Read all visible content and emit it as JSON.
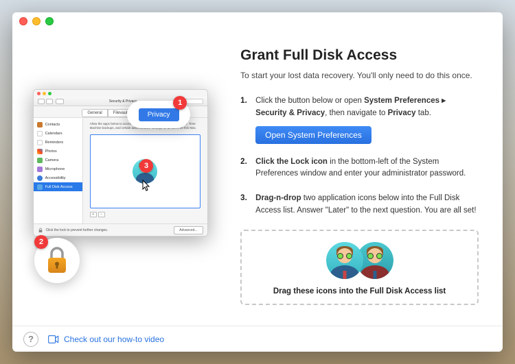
{
  "titlebar": {},
  "right": {
    "heading": "Grant Full Disk Access",
    "subtitle": "To start your lost data recovery. You'll only need to do this once.",
    "steps": {
      "s1a": "Click the button below or open ",
      "s1b": "System Preferences ▸ Security & Privacy",
      "s1c": ", then navigate to ",
      "s1d": "Privacy",
      "s1e": " tab.",
      "open_btn": "Open System Preferences",
      "s2a": "Click the Lock icon",
      "s2b": " in the bottom-left of the System Preferences window and enter your administrator password.",
      "s3a": "Drag-n-drop",
      "s3b": " two application icons below into the Full Disk Access list. Answer \"Later\" to the next question. You are all set!"
    },
    "drop_caption": "Drag these icons into the Full Disk Access list"
  },
  "prefwin": {
    "title": "Security & Privacy",
    "tabs": {
      "general": "General",
      "filevault": "Filevault",
      "privacy": "Privacy"
    },
    "side": {
      "contacts": "Contacts",
      "calendars": "Calendars",
      "reminders": "Reminders",
      "photos": "Photos",
      "camera": "Camera",
      "microphone": "Microphone",
      "accessibility": "Accessibility",
      "fulldisk": "Full Disk Access"
    },
    "desc": "Allow the apps below to access data like Mail, Messages, Safari, Home, Time Machine backups, and certain administrative settings for all users on this Mac.",
    "lock_text": "Click the lock to prevent further changes.",
    "advanced": "Advanced..."
  },
  "badges": {
    "one": "1",
    "two": "2",
    "three": "3"
  },
  "big_privacy": "Privacy",
  "footer": {
    "help": "?",
    "video_link": "Check out our how-to video"
  }
}
